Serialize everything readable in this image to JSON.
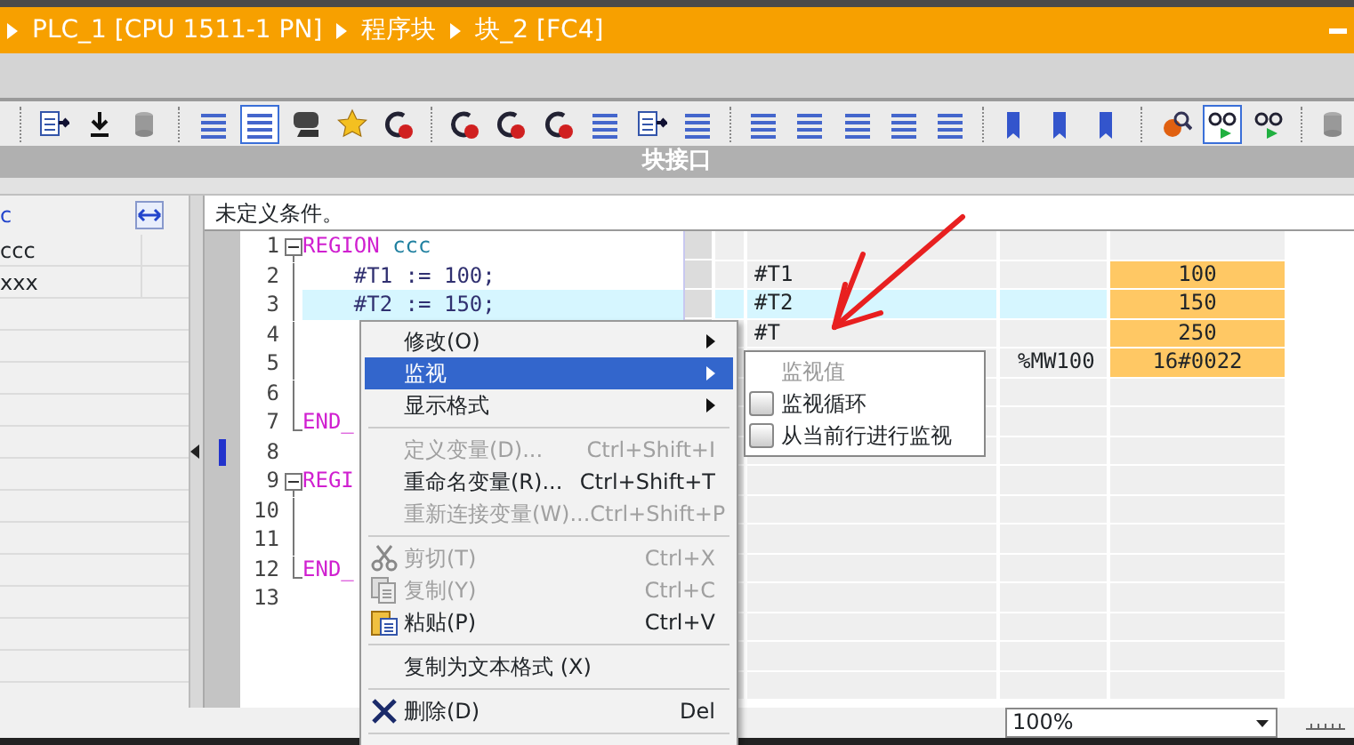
{
  "breadcrumb": [
    {
      "text": "PLC_1 [CPU 1511-1 PN]"
    },
    {
      "text": "程序块"
    },
    {
      "text": "块_2 [FC4]"
    }
  ],
  "toolbar": [
    {
      "kind": "separator"
    },
    {
      "kind": "button",
      "selected": false
    },
    {
      "kind": "button",
      "selected": false
    },
    {
      "kind": "button",
      "selected": false
    },
    {
      "kind": "separator"
    },
    {
      "kind": "button",
      "selected": false
    },
    {
      "kind": "button",
      "selected": true
    },
    {
      "kind": "button",
      "selected": false
    },
    {
      "kind": "button",
      "selected": false
    },
    {
      "kind": "button",
      "selected": false
    },
    {
      "kind": "separator"
    },
    {
      "kind": "button",
      "selected": false
    },
    {
      "kind": "button",
      "selected": false
    },
    {
      "kind": "button",
      "selected": false
    },
    {
      "kind": "button",
      "selected": false
    },
    {
      "kind": "button",
      "selected": false
    },
    {
      "kind": "button",
      "selected": false
    },
    {
      "kind": "separator"
    },
    {
      "kind": "button",
      "selected": false
    },
    {
      "kind": "button",
      "selected": false
    },
    {
      "kind": "button",
      "selected": false
    },
    {
      "kind": "button",
      "selected": false
    },
    {
      "kind": "button",
      "selected": false
    },
    {
      "kind": "separator"
    },
    {
      "kind": "button",
      "selected": false
    },
    {
      "kind": "button",
      "selected": false
    },
    {
      "kind": "button",
      "selected": false
    },
    {
      "kind": "separator"
    },
    {
      "kind": "button",
      "selected": false
    },
    {
      "kind": "button",
      "selected": true
    },
    {
      "kind": "button",
      "selected": false
    },
    {
      "kind": "separator"
    },
    {
      "kind": "button",
      "selected": false
    }
  ],
  "panel_title": "块接口",
  "left_panel": {
    "header": "c",
    "rows": [
      "ccc",
      "xxx"
    ]
  },
  "condition": "未定义条件。",
  "code_lines": [
    {
      "number": "1",
      "fold_start": true,
      "fold_end": false,
      "selected": false,
      "marker": false,
      "tokens": [
        {
          "text": "REGION",
          "kind": "keyword"
        },
        {
          "text": " ccc",
          "kind": "name"
        }
      ]
    },
    {
      "number": "2",
      "fold_start": false,
      "fold_end": false,
      "selected": false,
      "marker": false,
      "tokens": [
        {
          "text": "    #T1 := 100;",
          "kind": "code"
        }
      ],
      "watch_name": "#T1",
      "watch_value": "100"
    },
    {
      "number": "3",
      "fold_start": false,
      "fold_end": false,
      "selected": true,
      "marker": false,
      "tokens": [
        {
          "text": "    #T2 := 150;",
          "kind": "code"
        }
      ],
      "watch_name": "#T2",
      "watch_value": "150"
    },
    {
      "number": "4",
      "fold_start": false,
      "fold_end": false,
      "selected": false,
      "marker": false,
      "watch_name": "#T",
      "watch_value": "250"
    },
    {
      "number": "5",
      "fold_start": false,
      "fold_end": false,
      "selected": false,
      "marker": false,
      "watch_address": "%MW100",
      "watch_value": "16#0022"
    },
    {
      "number": "6",
      "fold_start": false,
      "fold_end": false,
      "selected": false,
      "marker": false
    },
    {
      "number": "7",
      "fold_start": false,
      "fold_end": true,
      "selected": false,
      "marker": false,
      "tokens": [
        {
          "text": "END_",
          "kind": "keyword"
        }
      ]
    },
    {
      "number": "8",
      "fold_start": false,
      "fold_end": false,
      "selected": false,
      "marker": true
    },
    {
      "number": "9",
      "fold_start": true,
      "fold_end": false,
      "selected": false,
      "marker": false,
      "tokens": [
        {
          "text": "REGI",
          "kind": "keyword"
        }
      ]
    },
    {
      "number": "10",
      "fold_start": false,
      "fold_end": false,
      "selected": false,
      "marker": false
    },
    {
      "number": "11",
      "fold_start": false,
      "fold_end": false,
      "selected": false,
      "marker": false
    },
    {
      "number": "12",
      "fold_start": false,
      "fold_end": true,
      "selected": false,
      "marker": false,
      "tokens": [
        {
          "text": "END_",
          "kind": "keyword"
        }
      ]
    },
    {
      "number": "13",
      "fold_start": false,
      "fold_end": false,
      "selected": false,
      "marker": false
    }
  ],
  "context_menu": [
    {
      "kind": "submenu",
      "label": "修改(O)",
      "disabled": false,
      "selected": false
    },
    {
      "kind": "submenu",
      "label": "监视",
      "disabled": false,
      "selected": true
    },
    {
      "kind": "submenu",
      "label": "显示格式",
      "disabled": false,
      "selected": false
    },
    {
      "kind": "separator"
    },
    {
      "kind": "command",
      "label": "定义变量(D)...",
      "shortcut": "Ctrl+Shift+I",
      "disabled": true,
      "selected": false
    },
    {
      "kind": "command",
      "label": "重命名变量(R)...",
      "shortcut": "Ctrl+Shift+T",
      "disabled": false,
      "selected": false
    },
    {
      "kind": "command",
      "label": "重新连接变量(W)...",
      "shortcut": "Ctrl+Shift+P",
      "disabled": true,
      "selected": false
    },
    {
      "kind": "separator"
    },
    {
      "kind": "cut",
      "label": "剪切(T)",
      "shortcut": "Ctrl+X",
      "disabled": true,
      "selected": false
    },
    {
      "kind": "copy",
      "label": "复制(Y)",
      "shortcut": "Ctrl+C",
      "disabled": true,
      "selected": false
    },
    {
      "kind": "paste",
      "label": "粘贴(P)",
      "shortcut": "Ctrl+V",
      "disabled": false,
      "selected": false
    },
    {
      "kind": "separator"
    },
    {
      "kind": "command",
      "label": "复制为文本格式 (X)",
      "disabled": false,
      "selected": false
    },
    {
      "kind": "separator"
    },
    {
      "kind": "delete",
      "label": "删除(D)",
      "shortcut": "Del",
      "disabled": false,
      "selected": false
    },
    {
      "kind": "separator"
    }
  ],
  "submenu": [
    {
      "kind": "header",
      "label": "监视值",
      "disabled": true
    },
    {
      "kind": "checkbox",
      "label": "监视循环",
      "checked": false,
      "disabled": false
    },
    {
      "kind": "checkbox",
      "label": "从当前行进行监视",
      "checked": false,
      "disabled": false
    }
  ],
  "zoom": "100%"
}
